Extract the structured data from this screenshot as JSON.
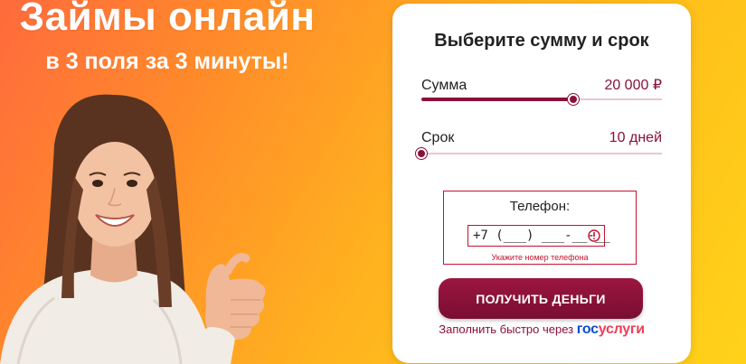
{
  "hero": {
    "title": "Займы онлайн",
    "subtitle": "в 3 поля за 3 минуты!"
  },
  "form": {
    "title": "Выберите сумму и срок",
    "amount": {
      "label": "Сумма",
      "value": "20 000 ₽",
      "slider_fraction": 0.63
    },
    "term": {
      "label": "Срок",
      "value": "10 дней",
      "slider_fraction": 0.0
    },
    "phone": {
      "label": "Телефон:",
      "value": "+7 (___) ___-__-__",
      "error": "Укажите номер телефона"
    },
    "submit_label": "ПОЛУЧИТЬ ДЕНЬГИ",
    "gosuslugi": {
      "prefix": "Заполнить быстро через",
      "logo_part1": "гос",
      "logo_part2": "услуги"
    }
  },
  "colors": {
    "accent": "#8a1038",
    "error": "#c8102e",
    "gos_blue": "#0d4cd3",
    "gos_red": "#ee3f58"
  },
  "icons": {
    "phone_error": "error-circle-icon"
  }
}
